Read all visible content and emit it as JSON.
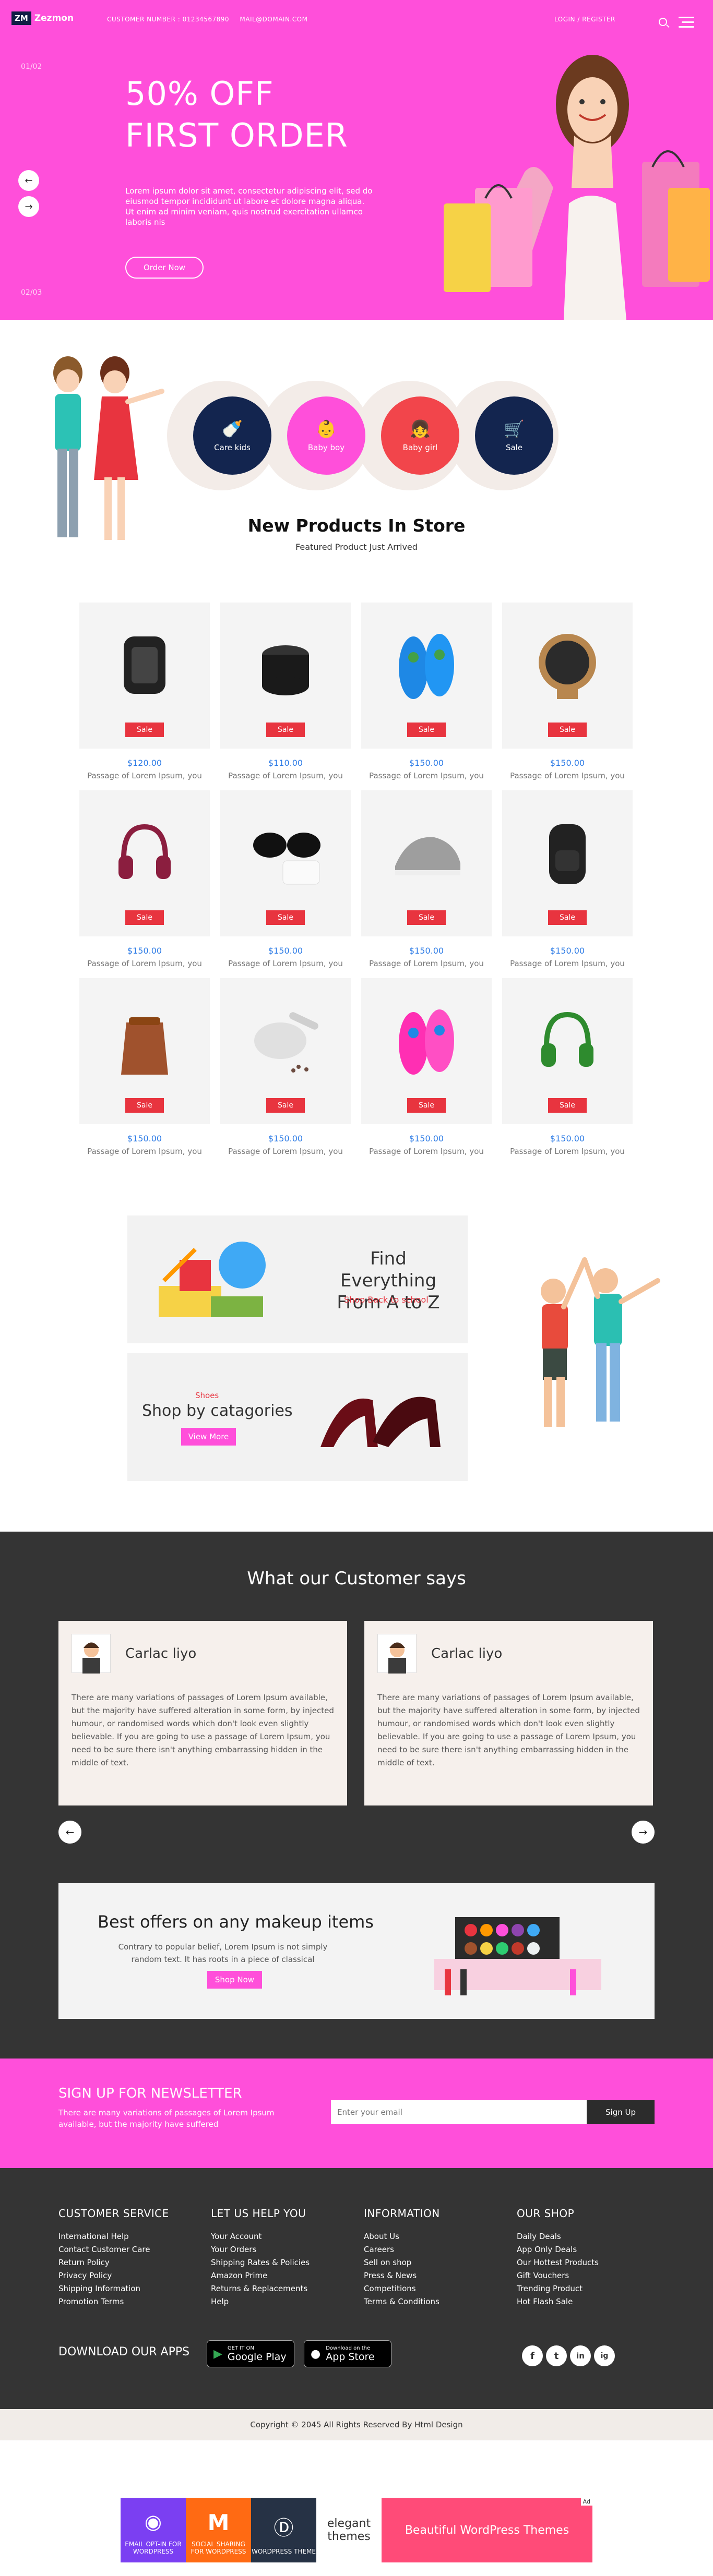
{
  "header": {
    "logo_mark": "ZM",
    "logo_name": "Zezmon",
    "customer_number": "CUSTOMER NUMBER : 01234567890",
    "email": "MAIL@DOMAIN.COM",
    "login": "LOGIN / REGISTER"
  },
  "hero": {
    "counter_top": "01/02",
    "counter_bottom": "02/03",
    "headline_1": "50% OFF",
    "headline_2": "FIRST ORDER",
    "text": "Lorem ipsum dolor sit amet, consectetur adipiscing elit, sed do eiusmod tempor incididunt ut labore et dolore magna aliqua. Ut enim ad minim veniam, quis nostrud exercitation ullamco laboris nis",
    "button": "Order Now",
    "prev_arrow": "←",
    "next_arrow": "→"
  },
  "categories": [
    {
      "label": "Care kids",
      "icon": "bottle-icon",
      "glyph": "🍼",
      "color": "#13254f"
    },
    {
      "label": "Baby boy",
      "icon": "baby-icon",
      "glyph": "👶",
      "color": "#ff4fda"
    },
    {
      "label": "Baby girl",
      "icon": "baby-girl-icon",
      "glyph": "👧",
      "color": "#f2454b"
    },
    {
      "label": "Sale",
      "icon": "stroller-icon",
      "glyph": "🛒",
      "color": "#13254f"
    }
  ],
  "products_section": {
    "title": "New Products In Store",
    "subtitle": "Featured Product Just Arrived"
  },
  "products": [
    {
      "name": "smart-watch",
      "sale": "Sale",
      "price": "$120.00",
      "desc": "Passage of Lorem Ipsum, you"
    },
    {
      "name": "speaker",
      "sale": "Sale",
      "price": "$110.00",
      "desc": "Passage of Lorem Ipsum, you"
    },
    {
      "name": "blue-slippers",
      "sale": "Sale",
      "price": "$150.00",
      "desc": "Passage of Lorem Ipsum, you"
    },
    {
      "name": "fan",
      "sale": "Sale",
      "price": "$150.00",
      "desc": "Passage of Lorem Ipsum, you"
    },
    {
      "name": "headphones-red",
      "sale": "Sale",
      "price": "$150.00",
      "desc": "Passage of Lorem Ipsum, you"
    },
    {
      "name": "sunglasses",
      "sale": "Sale",
      "price": "$150.00",
      "desc": "Passage of Lorem Ipsum, you"
    },
    {
      "name": "sneaker",
      "sale": "Sale",
      "price": "$150.00",
      "desc": "Passage of Lorem Ipsum, you"
    },
    {
      "name": "backpack",
      "sale": "Sale",
      "price": "$150.00",
      "desc": "Passage of Lorem Ipsum, you"
    },
    {
      "name": "leather-bag",
      "sale": "Sale",
      "price": "$150.00",
      "desc": "Passage of Lorem Ipsum, you"
    },
    {
      "name": "mortar",
      "sale": "Sale",
      "price": "$150.00",
      "desc": "Passage of Lorem Ipsum, you"
    },
    {
      "name": "pink-slippers",
      "sale": "Sale",
      "price": "$150.00",
      "desc": "Passage of Lorem Ipsum, you"
    },
    {
      "name": "headphones-green",
      "sale": "Sale",
      "price": "$150.00",
      "desc": "Passage of Lorem Ipsum, you"
    }
  ],
  "promo": {
    "find_title_1": "Find Everything",
    "find_title_2": "From A to Z",
    "find_link": "Shop Back to school",
    "shoes_label": "Shoes",
    "shoes_title": "Shop by catagories",
    "shoes_button": "View More"
  },
  "testimonials": {
    "title": "What our Customer says",
    "items": [
      {
        "name": "Carlac liyo",
        "text": "There are many variations of passages of Lorem Ipsum available, but the majority have suffered alteration in some form, by injected humour, or randomised words which don't look even slightly believable. If you are going to use a passage of Lorem Ipsum, you need to be sure there isn't anything embarrassing hidden in the middle of text."
      },
      {
        "name": "Carlac liyo",
        "text": "There are many variations of passages of Lorem Ipsum available, but the majority have suffered alteration in some form, by injected humour, or randomised words which don't look even slightly believable. If you are going to use a passage of Lorem Ipsum, you need to be sure there isn't anything embarrassing hidden in the middle of text."
      }
    ],
    "prev": "←",
    "next": "→"
  },
  "offer": {
    "title": "Best offers on any makeup items",
    "text": "Contrary to popular belief, Lorem Ipsum is not simply random text. It has roots in a piece of classical",
    "button": "Shop Now"
  },
  "newsletter": {
    "title": "SIGN UP FOR NEWSLETTER",
    "text": "There are many variations of passages of Lorem Ipsum available, but the majority have suffered",
    "placeholder": "Enter your email",
    "button": "Sign Up"
  },
  "footer": {
    "columns": [
      {
        "title": "CUSTOMER SERVICE",
        "links": [
          "International Help",
          "Contact Customer Care",
          "Return Policy",
          "Privacy Policy",
          "Shipping Information",
          "Promotion Terms"
        ]
      },
      {
        "title": "LET US HELP YOU",
        "links": [
          "Your Account",
          "Your Orders",
          "Shipping Rates & Policies",
          "Amazon Prime",
          "Returns & Replacements",
          "Help"
        ]
      },
      {
        "title": "INFORMATION",
        "links": [
          "About Us",
          "Careers",
          "Sell on shop",
          "Press & News",
          "Competitions",
          "Terms & Conditions"
        ]
      },
      {
        "title": "OUR SHOP",
        "links": [
          "Daily Deals",
          "App Only Deals",
          "Our Hottest Products",
          "Gift Vouchers",
          "Trending Product",
          "Hot Flash Sale"
        ]
      }
    ],
    "apps_title": "DOWNLOAD OUR APPS",
    "google_small": "GET IT ON",
    "google_big": "Google Play",
    "apple_small": "Download on the",
    "apple_big": "App Store",
    "social": [
      "f",
      "t",
      "in",
      "ig"
    ],
    "copyright": "Copyright © 2045 All Rights Reserved By Html Design"
  },
  "ad": {
    "tag": "Ad",
    "items": [
      {
        "label": "EMAIL OPT-IN FOR WORDPRESS",
        "color": "#7b3ff2"
      },
      {
        "label": "SOCIAL SHARING FOR WORDPRESS",
        "color": "#ff6a13"
      },
      {
        "label": "WORDPRESS THEME",
        "color": "#263245"
      },
      {
        "label": "elegant themes",
        "color": "#ffffff"
      }
    ],
    "headline": "Beautiful WordPress Themes"
  }
}
